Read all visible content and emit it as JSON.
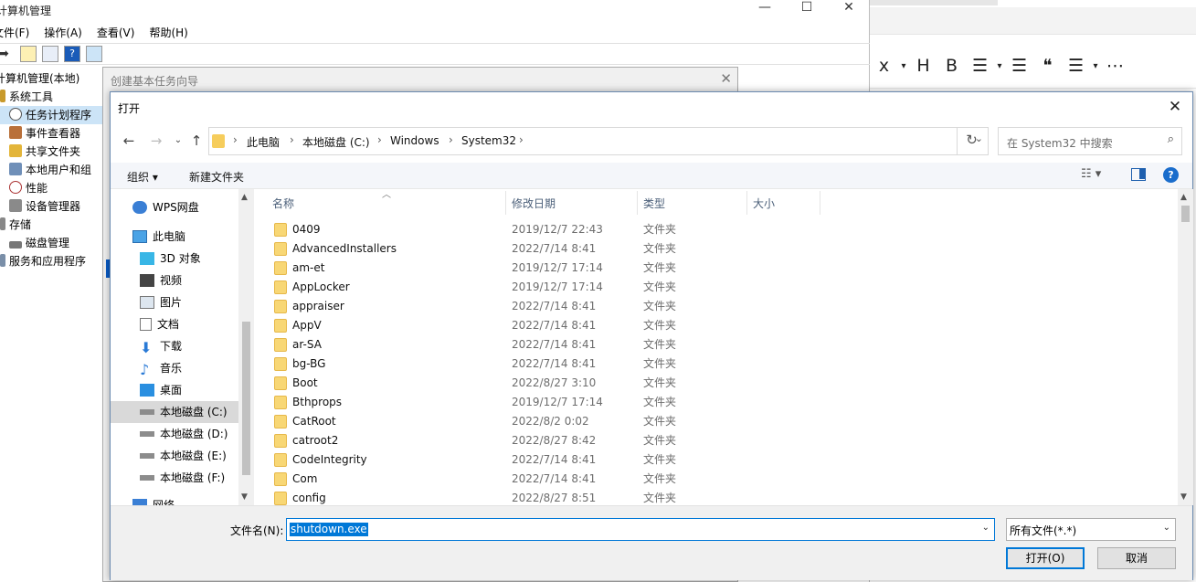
{
  "computer_management": {
    "title": "计算机管理",
    "menu": [
      "文件(F)",
      "操作(A)",
      "查看(V)",
      "帮助(H)"
    ],
    "tree": [
      {
        "label": "计算机管理(本地)",
        "indent": 0
      },
      {
        "label": "系统工具",
        "indent": 1
      },
      {
        "label": "任务计划程序",
        "indent": 2,
        "selected": true
      },
      {
        "label": "事件查看器",
        "indent": 2
      },
      {
        "label": "共享文件夹",
        "indent": 2
      },
      {
        "label": "本地用户和组",
        "indent": 2
      },
      {
        "label": "性能",
        "indent": 2
      },
      {
        "label": "设备管理器",
        "indent": 2
      },
      {
        "label": "存储",
        "indent": 1
      },
      {
        "label": "磁盘管理",
        "indent": 2
      },
      {
        "label": "服务和应用程序",
        "indent": 1
      }
    ]
  },
  "wizard": {
    "title": "创建基本任务向导"
  },
  "dialog": {
    "title": "打开",
    "address": {
      "crumbs": [
        "此电脑",
        "本地磁盘 (C:)",
        "Windows",
        "System32"
      ]
    },
    "search_placeholder": "在 System32 中搜索",
    "commands": {
      "organize": "组织 ▾",
      "new_folder": "新建文件夹"
    },
    "sidebar": [
      {
        "label": "WPS网盘",
        "icon": "cloud-icon"
      },
      {
        "label": "此电脑",
        "icon": "computer-icon"
      },
      {
        "label": "3D 对象",
        "icon": "cube-icon"
      },
      {
        "label": "视频",
        "icon": "video-icon"
      },
      {
        "label": "图片",
        "icon": "picture-icon"
      },
      {
        "label": "文档",
        "icon": "document-icon"
      },
      {
        "label": "下载",
        "icon": "download-icon"
      },
      {
        "label": "音乐",
        "icon": "music-icon"
      },
      {
        "label": "桌面",
        "icon": "desktop-icon"
      },
      {
        "label": "本地磁盘 (C:)",
        "icon": "drive-icon",
        "selected": true
      },
      {
        "label": "本地磁盘 (D:)",
        "icon": "drive-icon"
      },
      {
        "label": "本地磁盘 (E:)",
        "icon": "drive-icon"
      },
      {
        "label": "本地磁盘 (F:)",
        "icon": "drive-icon"
      },
      {
        "label": "网络",
        "icon": "network-icon"
      }
    ],
    "columns": [
      "名称",
      "修改日期",
      "类型",
      "大小"
    ],
    "files": [
      {
        "name": "0409",
        "date": "2019/12/7 22:43",
        "type": "文件夹"
      },
      {
        "name": "AdvancedInstallers",
        "date": "2022/7/14 8:41",
        "type": "文件夹"
      },
      {
        "name": "am-et",
        "date": "2019/12/7 17:14",
        "type": "文件夹"
      },
      {
        "name": "AppLocker",
        "date": "2019/12/7 17:14",
        "type": "文件夹"
      },
      {
        "name": "appraiser",
        "date": "2022/7/14 8:41",
        "type": "文件夹"
      },
      {
        "name": "AppV",
        "date": "2022/7/14 8:41",
        "type": "文件夹"
      },
      {
        "name": "ar-SA",
        "date": "2022/7/14 8:41",
        "type": "文件夹"
      },
      {
        "name": "bg-BG",
        "date": "2022/7/14 8:41",
        "type": "文件夹"
      },
      {
        "name": "Boot",
        "date": "2022/8/27 3:10",
        "type": "文件夹"
      },
      {
        "name": "Bthprops",
        "date": "2019/12/7 17:14",
        "type": "文件夹"
      },
      {
        "name": "CatRoot",
        "date": "2022/8/2 0:02",
        "type": "文件夹"
      },
      {
        "name": "catroot2",
        "date": "2022/8/27 8:42",
        "type": "文件夹"
      },
      {
        "name": "CodeIntegrity",
        "date": "2022/7/14 8:41",
        "type": "文件夹"
      },
      {
        "name": "Com",
        "date": "2022/7/14 8:41",
        "type": "文件夹"
      },
      {
        "name": "config",
        "date": "2022/8/27 8:51",
        "type": "文件夹"
      }
    ],
    "filename_label": "文件名(N):",
    "filename_value": "shutdown.exe",
    "filter_value": "所有文件(*.*)",
    "open_label": "打开(O)",
    "cancel_label": "取消"
  },
  "editor_toolbar": [
    "x",
    "▾",
    "H",
    "B",
    "☰",
    "▾",
    "☰",
    "❝",
    "☰",
    "▾",
    "⋯"
  ]
}
